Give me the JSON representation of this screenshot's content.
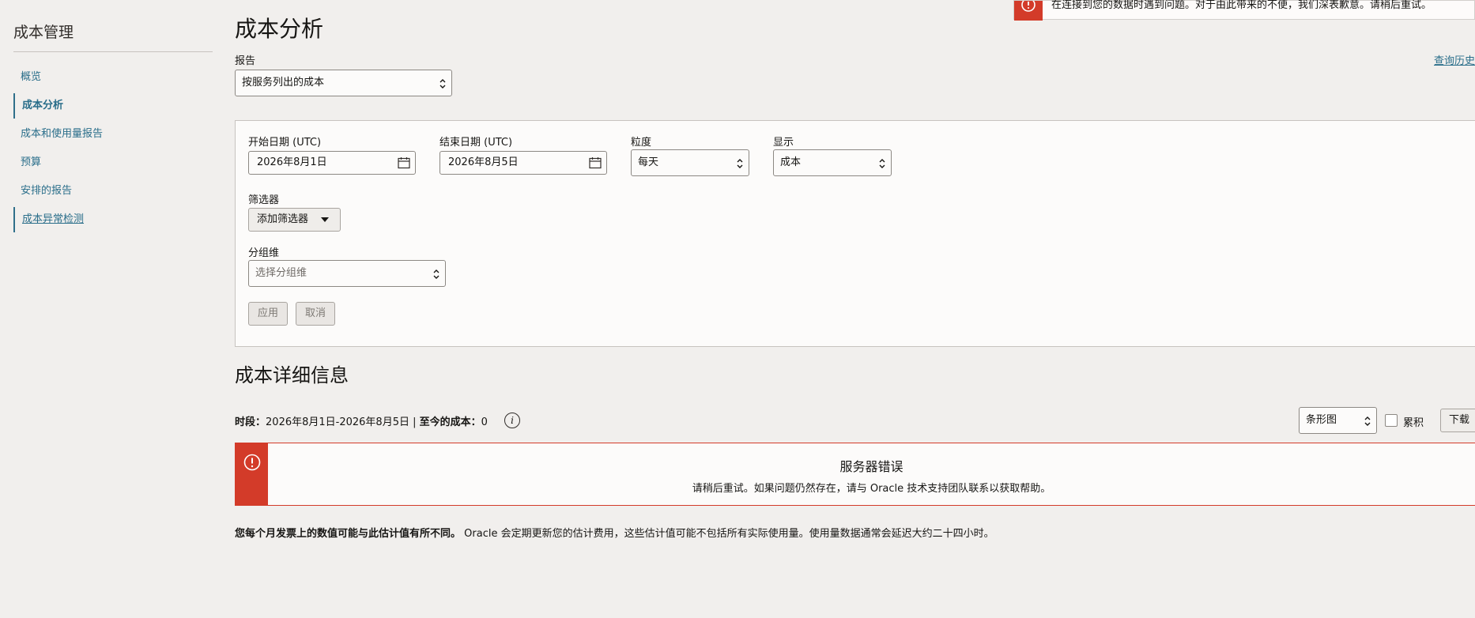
{
  "sidebar": {
    "title": "成本管理",
    "items": [
      {
        "label": "概览"
      },
      {
        "label": "成本分析"
      },
      {
        "label": "成本和使用量报告"
      },
      {
        "label": "预算"
      },
      {
        "label": "安排的报告"
      },
      {
        "label": "成本异常检测"
      }
    ]
  },
  "header": {
    "title": "成本分析",
    "report_label": "报告",
    "report_value": "按服务列出的成本",
    "history_link": "查询历史"
  },
  "toast": {
    "message": "在连接到您的数据时遇到问题。对于由此带来的不便，我们深表歉意。请稍后重试。"
  },
  "filters": {
    "start_label": "开始日期 (UTC)",
    "start_value": "2026年8月1日",
    "end_label": "结束日期 (UTC)",
    "end_value": "2026年8月5日",
    "granularity_label": "粒度",
    "granularity_value": "每天",
    "display_label": "显示",
    "display_value": "成本",
    "filter_label": "筛选器",
    "add_filter": "添加筛选器",
    "group_label": "分组维",
    "group_placeholder": "选择分组维",
    "apply": "应用",
    "cancel": "取消"
  },
  "details": {
    "title": "成本详细信息",
    "period_label": "时段",
    "period_value": "2026年8月1日-2026年8月5日",
    "cost_label": "至今的成本",
    "cost_value": "0",
    "chart_type": "条形图",
    "cumulative": "累积",
    "download": "下载"
  },
  "error": {
    "title": "服务器错误",
    "message": "请稍后重试。如果问题仍然存在，请与 Oracle 技术支持团队联系以获取帮助。"
  },
  "note": {
    "bold": "您每个月发票上的数值可能与此估计值有所不同。",
    "text": "Oracle 会定期更新您的估计费用，这些估计值可能不包括所有实际使用量。使用量数据通常会延迟大约二十四小时。"
  },
  "colors": {
    "accent": "#2a6e8a",
    "error": "#d33b29",
    "background": "#f1efed"
  }
}
